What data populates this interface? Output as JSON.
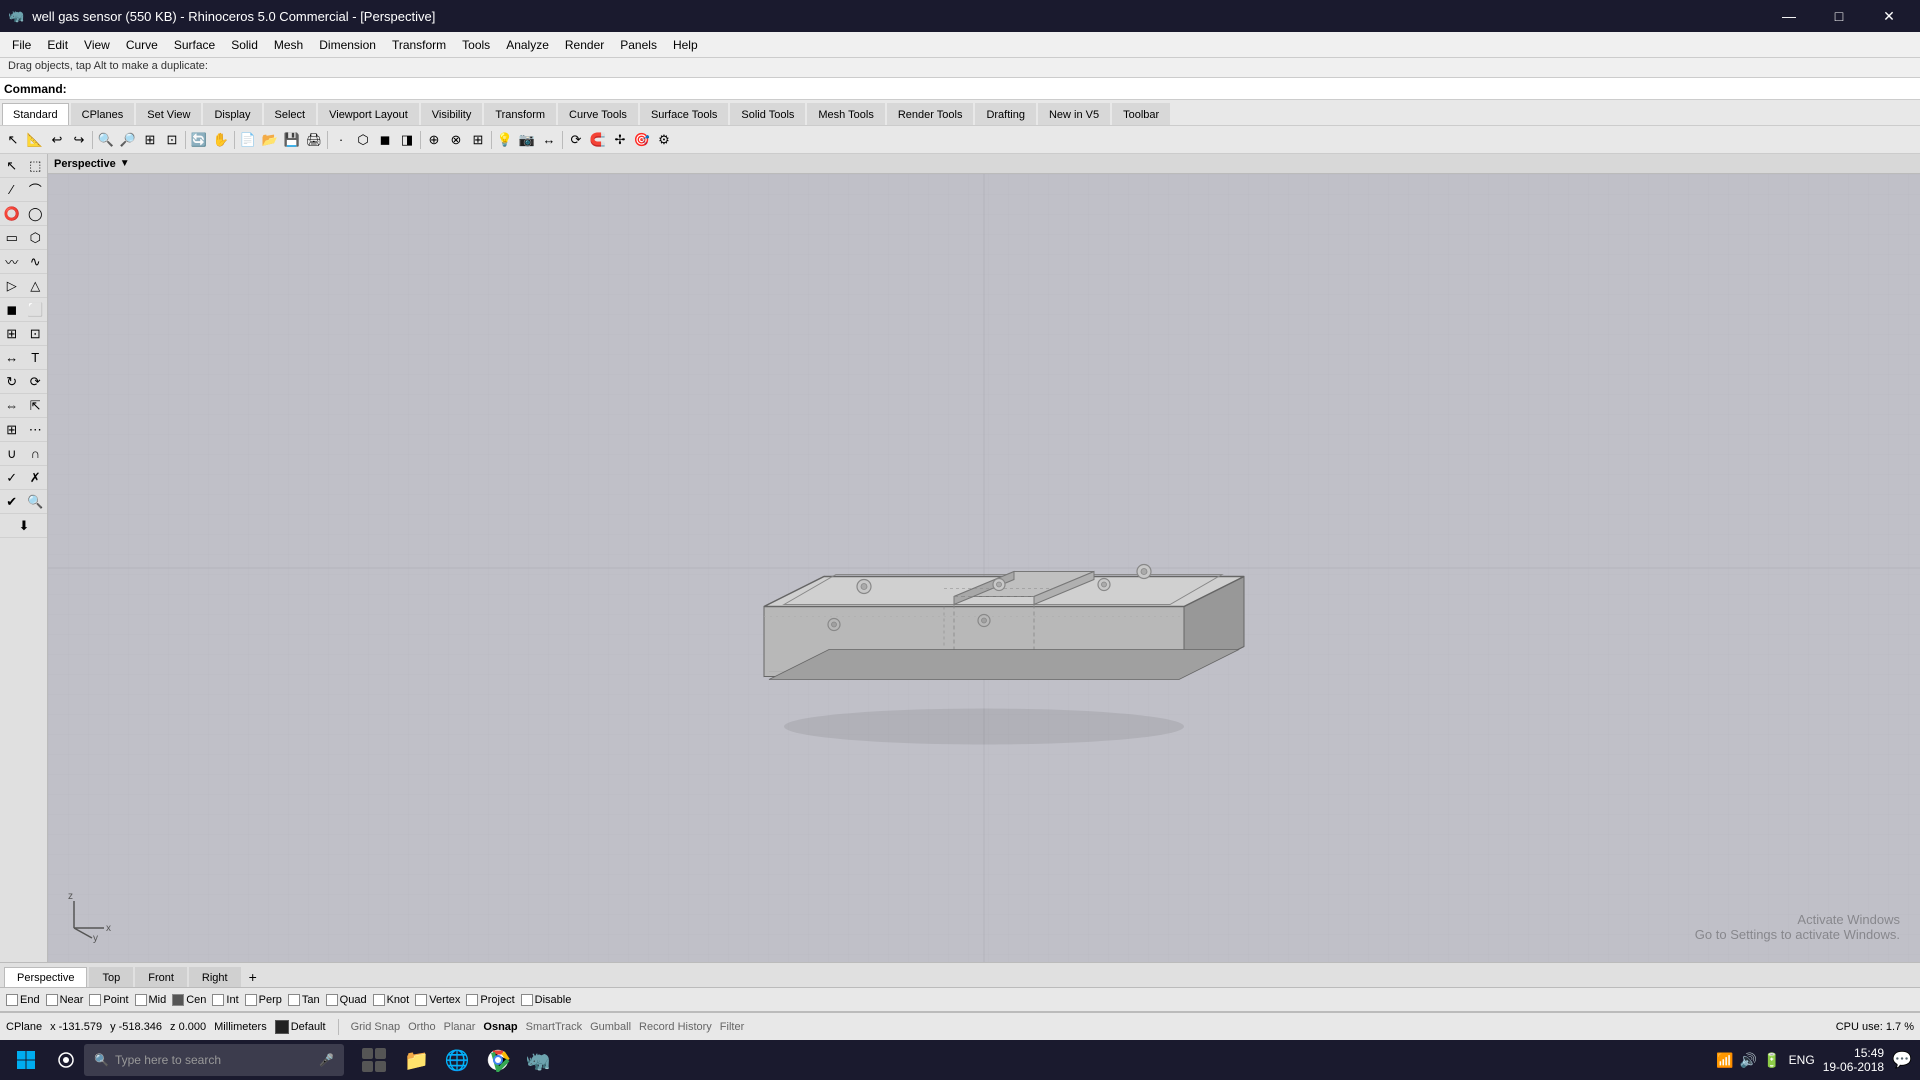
{
  "titlebar": {
    "title": "well gas sensor (550 KB) - Rhinoceros 5.0 Commercial - [Perspective]",
    "icon": "🦏",
    "minimize": "—",
    "maximize": "□",
    "close": "✕"
  },
  "menubar": {
    "items": [
      "File",
      "Edit",
      "View",
      "Curve",
      "Surface",
      "Solid",
      "Mesh",
      "Dimension",
      "Transform",
      "Tools",
      "Analyze",
      "Render",
      "Panels",
      "Help"
    ]
  },
  "statusbar": {
    "text": "Drag objects, tap Alt to make a duplicate:"
  },
  "commandbar": {
    "label": "Command:",
    "value": ""
  },
  "toolbar_tabs": {
    "items": [
      "Standard",
      "CPlanes",
      "Set View",
      "Display",
      "Select",
      "Viewport Layout",
      "Visibility",
      "Transform",
      "Curve Tools",
      "Surface Tools",
      "Solid Tools",
      "Mesh Tools",
      "Render Tools",
      "Drafting",
      "New in V5",
      "Toolbar"
    ]
  },
  "viewport": {
    "label": "Perspective",
    "activate_windows_line1": "Activate Windows",
    "activate_windows_line2": "Go to Settings to activate Windows."
  },
  "viewport_tabs": {
    "items": [
      "Perspective",
      "Top",
      "Front",
      "Right"
    ],
    "plus": "+"
  },
  "osnap": {
    "items": [
      {
        "label": "End",
        "checked": false
      },
      {
        "label": "Near",
        "checked": false
      },
      {
        "label": "Point",
        "checked": false
      },
      {
        "label": "Mid",
        "checked": false
      },
      {
        "label": "Cen",
        "checked": true
      },
      {
        "label": "Int",
        "checked": false
      },
      {
        "label": "Perp",
        "checked": false
      },
      {
        "label": "Tan",
        "checked": false
      },
      {
        "label": "Quad",
        "checked": false
      },
      {
        "label": "Knot",
        "checked": false
      },
      {
        "label": "Vertex",
        "checked": false
      },
      {
        "label": "Project",
        "checked": false
      },
      {
        "label": "Disable",
        "checked": false
      }
    ]
  },
  "status_row": {
    "cplane": "CPlane",
    "x": "x -131.579",
    "y": "y -518.346",
    "z": "z 0.000",
    "unit": "Millimeters",
    "color_label": "Default",
    "items": [
      "Grid Snap",
      "Ortho",
      "Planar",
      "Osnap",
      "SmartTrack",
      "Gumball",
      "Record History",
      "Filter"
    ],
    "active": "Osnap",
    "cpu": "CPU use: 1.7 %"
  },
  "taskbar": {
    "search_placeholder": "Type here to search",
    "time": "15:49",
    "date": "19-06-2018",
    "lang": "ENG"
  },
  "sidebar_icons": [
    "↖",
    "↗",
    "⟲",
    "✚",
    "⬚",
    "⭕",
    "〰",
    "▷",
    "⬡",
    "🔧",
    "↩",
    "🔄",
    "🔲",
    "🔳",
    "☑",
    "△"
  ]
}
